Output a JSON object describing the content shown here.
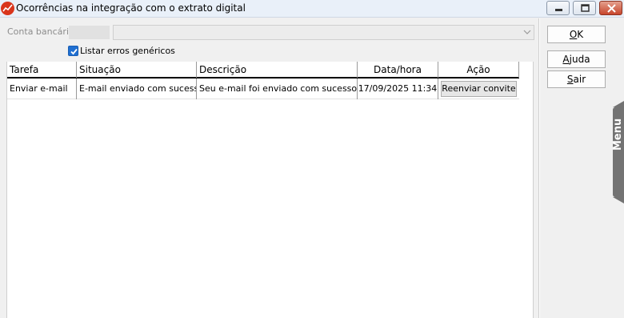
{
  "window": {
    "title": "Ocorrências na integração com o extrato digital",
    "app_icon": "chart-icon",
    "controls": [
      "minimize-icon",
      "maximize-icon",
      "close-icon"
    ]
  },
  "filter": {
    "conta_label": "Conta bancária",
    "conta_code": "",
    "conta_selected": ""
  },
  "options": {
    "listar_erros_label": "Listar erros genéricos",
    "listar_erros_checked": true
  },
  "grid": {
    "columns": [
      "Tarefa",
      "Situação",
      "Descrição",
      "Data/hora",
      "Ação"
    ],
    "rows": [
      {
        "tarefa": "Enviar e-mail",
        "situacao": "E-mail enviado com sucesso.",
        "descricao": "Seu e-mail foi enviado com sucesso e está",
        "data_hora": "17/09/2025 11:34",
        "acao": "Reenviar convite"
      }
    ]
  },
  "actions": {
    "ok_label": "OK",
    "ok_mnemonic": "O",
    "ok_rest": "K",
    "ajuda_label": "Ajuda",
    "ajuda_mnemonic": "A",
    "ajuda_rest": "juda",
    "sair_label": "Sair",
    "sair_mnemonic": "S",
    "sair_rest": "air"
  },
  "side_menu": {
    "label": "Menu"
  },
  "colors": {
    "titlebar": "#e9f0f9",
    "checkbox_accent": "#1f6fd1",
    "app_icon": "#d9351c",
    "menu_tab": "#737373"
  }
}
